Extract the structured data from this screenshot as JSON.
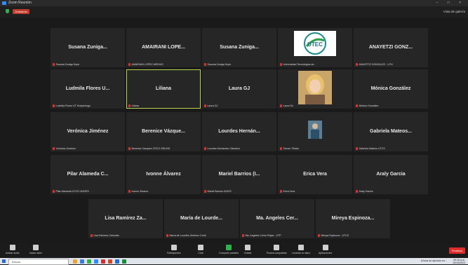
{
  "window": {
    "title": "Zoom Reunión",
    "controls": "– □ ×"
  },
  "topbar": {
    "recording_label": "Grabando",
    "view_label": "Vista de galería"
  },
  "participants": [
    {
      "display": "Susana Zuniga...",
      "sub": "Susana Zuniga Hope",
      "type": "name"
    },
    {
      "display": "AMAIRANI LOPE...",
      "sub": "AMAIRANI LOPEZ MEDIUS",
      "type": "name"
    },
    {
      "display": "Susana Zuniga...",
      "sub": "Susana Zuniga Hope",
      "type": "name"
    },
    {
      "display": "",
      "sub": "Universidad Tecnológica de...",
      "type": "logo",
      "logo_text": "UTEC"
    },
    {
      "display": "ANAYETZI GONZ...",
      "sub": "ANAYETZI GONZALEZ - UTH",
      "type": "name"
    },
    {
      "display": "Ludmila Flores U...",
      "sub": "Ludmila Flores UT Huejotzingo",
      "type": "name"
    },
    {
      "display": "Liliana",
      "sub": "Liliana",
      "type": "name",
      "active": true
    },
    {
      "display": "Laura GJ",
      "sub": "Laura GJ",
      "type": "name"
    },
    {
      "display": "",
      "sub": "Laura Sc",
      "type": "photo"
    },
    {
      "display": "Mónica González",
      "sub": "Mónica González",
      "type": "name"
    },
    {
      "display": "Verónica Jiménez",
      "sub": "Verónica Jiménez",
      "type": "name"
    },
    {
      "display": "Berenice Vázque...",
      "sub": "Berenice Vázquez CRCS ORLINS",
      "type": "name"
    },
    {
      "display": "Lourdes Hernán...",
      "sub": "Lourdes Hernández Sánchez",
      "type": "name"
    },
    {
      "display": "",
      "sub": "Tomas Tiñado",
      "type": "small-photo"
    },
    {
      "display": "Gabriela Mateos...",
      "sub": "Gabriela Mateos UTCS",
      "type": "name"
    },
    {
      "display": "Pilar Alameda C...",
      "sub": "Pilar Alameda UTCS UNIVES",
      "type": "name"
    },
    {
      "display": "Ivonne Álvarez",
      "sub": "Ivonne Álvarez",
      "type": "name"
    },
    {
      "display": "Mariel Barrios (I...",
      "sub": "Mariel Barrios UNIVS",
      "type": "name"
    },
    {
      "display": "Erica Vera",
      "sub": "Erica Vera",
      "type": "name"
    },
    {
      "display": "Araly Garcia",
      "sub": "Araly García",
      "type": "name"
    },
    {
      "display": "Lisa Ramírez Za...",
      "sub": "Lisa Ramírez Zamudio",
      "type": "name"
    },
    {
      "display": "María de Lourde...",
      "sub": "María de Lourdes Jiménez Conti",
      "type": "name"
    },
    {
      "display": "Ma. Angeles Cer...",
      "sub": "Ma. Angeles Cerón Rojas - UTP",
      "type": "name"
    },
    {
      "display": "Mireya Espinoza...",
      "sub": "Mireya Espinoza - UTCS",
      "type": "name"
    }
  ],
  "toolbar": {
    "items": [
      {
        "label": "Activar audio",
        "icon": "microphone-icon",
        "color": "#cfcfcf"
      },
      {
        "label": "Iniciar video",
        "icon": "camera-icon",
        "color": "#cfcfcf"
      },
      {
        "label": "Participantes",
        "icon": "participants-icon",
        "color": "#cfcfcf",
        "count": "24"
      },
      {
        "label": "Chat",
        "icon": "chat-icon",
        "color": "#cfcfcf"
      },
      {
        "label": "Compartir pantalla",
        "icon": "share-screen-icon",
        "color": "#2fb24c"
      },
      {
        "label": "Grabar",
        "icon": "record-icon",
        "color": "#cfcfcf"
      },
      {
        "label": "Pizarra compartida",
        "icon": "whiteboard-icon",
        "color": "#cfcfcf"
      },
      {
        "label": "Levantar la mano",
        "icon": "raise-hand-icon",
        "color": "#cfcfcf"
      },
      {
        "label": "Aplicaciones",
        "icon": "apps-icon",
        "color": "#cfcfcf"
      }
    ],
    "end_label": "Finalizar"
  },
  "taskbar": {
    "search_placeholder": "Buscar",
    "tray_text": "Ahora se ejecuta en...",
    "time": "09:15 a.m.",
    "date": "10/10/2023"
  }
}
